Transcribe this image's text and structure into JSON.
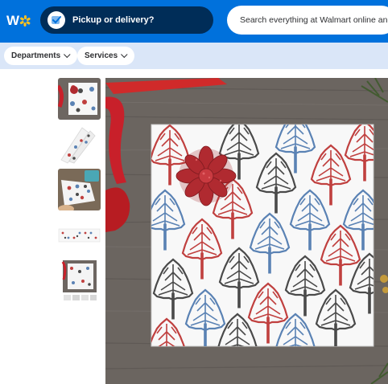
{
  "header": {
    "logo_icon": "walmart-spark-icon",
    "pickup_label": "Pickup or delivery?",
    "pickup_icon": "delivery-check-icon",
    "search_placeholder": "Search everything at Walmart online and in store"
  },
  "subnav": {
    "departments_label": "Departments",
    "services_label": "Services"
  },
  "gallery": {
    "thumbnails": [
      {
        "description_icon": "wrapped-gift-thumbnail"
      },
      {
        "description_icon": "paper-rolls-thumbnail"
      },
      {
        "description_icon": "wrapping-in-progress-thumbnail"
      },
      {
        "description_icon": "paper-strip-thumbnail"
      },
      {
        "description_icon": "product-collage-thumbnail"
      }
    ]
  },
  "colors": {
    "header_blue": "#0071dc",
    "pickup_navy": "#002d58",
    "subnav_bg": "#dae6f8",
    "spark_yellow": "#ffc220",
    "ribbon_red": "#c8202a",
    "tree_red": "#c0403f",
    "tree_blue": "#5a82b4",
    "tree_gray": "#4a4a4a",
    "wood": "#6b6560"
  }
}
